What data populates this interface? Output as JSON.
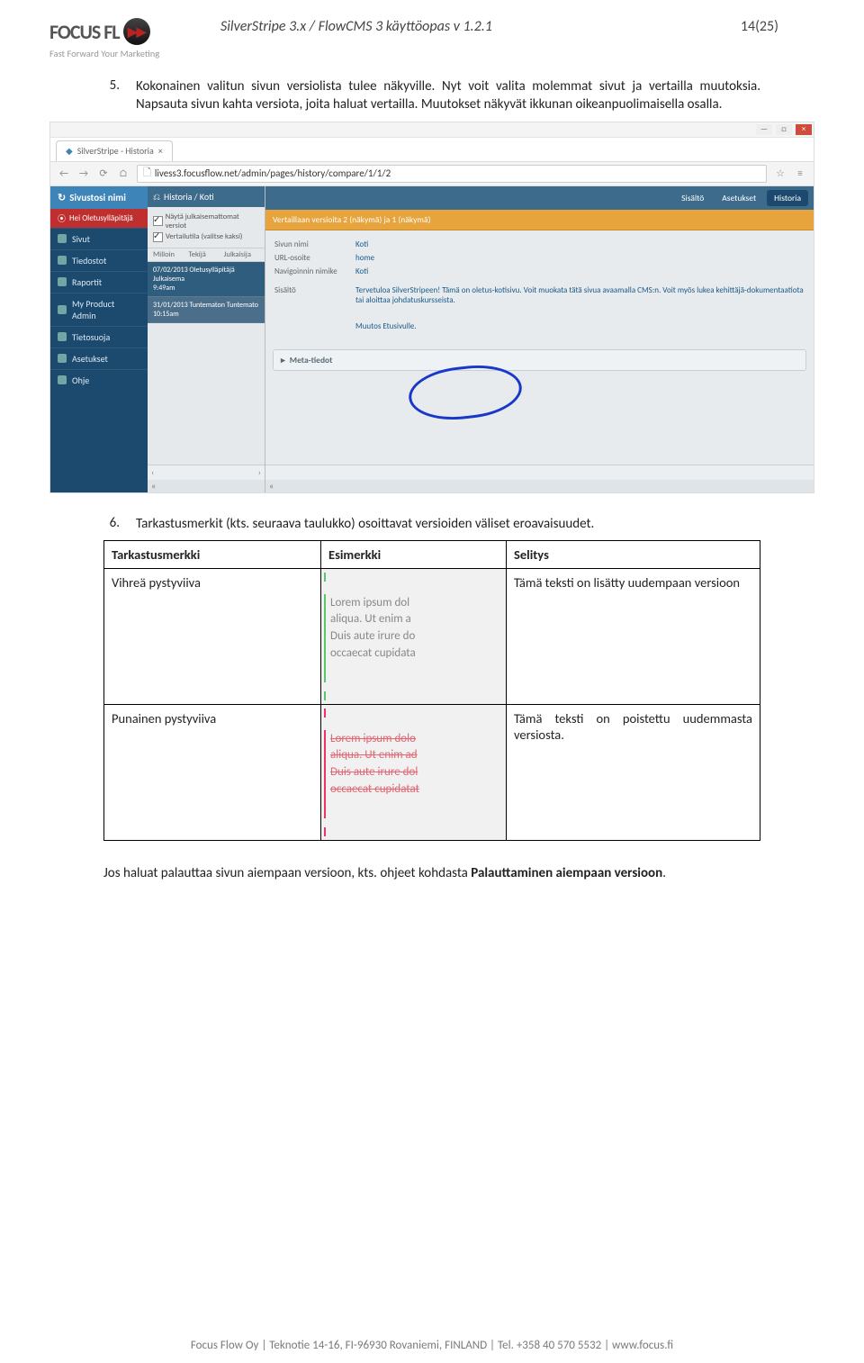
{
  "header": {
    "logo_text": "FOCUS FL",
    "logo_icon": "▶▶",
    "tagline": "Fast Forward Your Marketing",
    "doc_title": "SilverStripe 3.x / FlowCMS 3 käyttöopas v 1.2.1",
    "page_counter": "14(25)"
  },
  "steps": {
    "s5_num": "5.",
    "s5_text": "Kokonainen valitun sivun versiolista tulee näkyville. Nyt voit valita molemmat sivut ja vertailla muutoksia. Napsauta sivun kahta versiota, joita haluat vertailla. Muutokset näkyvät ikkunan oikeanpuolimaisella osalla.",
    "s6_num": "6.",
    "s6_text": "Tarkastusmerkit (kts. seuraava taulukko) osoittavat versioiden väliset eroavaisuudet."
  },
  "screenshot": {
    "window_min": "—",
    "window_max": "□",
    "window_close": "×",
    "tab_title": "SilverStripe - Historia",
    "tab_close": "×",
    "nav_back": "←",
    "nav_fwd": "→",
    "nav_reload": "⟳",
    "nav_home": "⌂",
    "url": "livess3.focusflow.net/admin/pages/history/compare/1/1/2",
    "star": "☆",
    "menu": "≡",
    "site_name": "Sivustosi nimi",
    "hello": "Hei Oletusylläpitäjä",
    "nav": [
      "Sivut",
      "Tiedostot",
      "Raportit",
      "My Product Admin",
      "Tietosuoja",
      "Asetukset",
      "Ohje"
    ],
    "mid_breadcrumb": "Historia / Koti",
    "chk1": "Näytä julkaisemattomat versiot",
    "chk2": "Vertailutila (valitse kaksi)",
    "th_when": "Milloin",
    "th_who": "Tekijä",
    "th_pub": "Julkaisija",
    "row1": "07/02/2013  Oletusylläpitäjä  Julkaisema",
    "row1_time": "9:49am",
    "row2": "31/01/2013  Tuntematon  Tuntemato",
    "row2_time": "10:15am",
    "tabs": {
      "content": "Sisältö",
      "settings": "Asetukset",
      "history": "Historia"
    },
    "banner": "Vertaillaan versioita 2 (näkymä) ja 1 (näkymä)",
    "fields": {
      "name_lbl": "Sivun nimi",
      "name_val": "Koti",
      "url_lbl": "URL-osoite",
      "url_val": "home",
      "nav_lbl": "Navigoinnin nimike",
      "nav_val": "Koti",
      "content_lbl": "Sisältö",
      "content_val": "Tervetuloa SilverStripeen! Tämä on oletus-kotisivu. Voit muokata tätä sivua avaamalla CMS:n. Voit myös lukea kehittäjä-dokumentaatiota tai aloittaa johdatuskursseista.",
      "content_change": "Muutos Etusivulle."
    },
    "accordion": "Meta-tiedot",
    "acc_arrow": "▸",
    "scroll_l": "‹",
    "scroll_r": "›",
    "scroll_ll": "«",
    "scroll_rr": "«"
  },
  "table": {
    "h1": "Tarkastusmerkki",
    "h2": "Esimerkki",
    "h3": "Selitys",
    "r1_label": "Vihreä pystyviiva",
    "r1_desc": "Tämä teksti on lisätty uudempaan versioon",
    "r1_ex_l1": "Lorem ipsum dol",
    "r1_ex_l2": "aliqua. Ut enim a",
    "r1_ex_l3": "Duis aute irure do",
    "r1_ex_l4": "occaecat cupidata",
    "r2_label": "Punainen pystyviiva",
    "r2_desc": "Tämä teksti on poistettu uudemmasta versiosta.",
    "r2_ex_l1": "Lorem ipsum dolo",
    "r2_ex_l2": "aliqua. Ut enim ad",
    "r2_ex_l3": "Duis aute irure dol",
    "r2_ex_l4": "occaecat cupidatat"
  },
  "final": {
    "text_a": "Jos haluat palauttaa sivun aiempaan versioon, kts. ohjeet kohdasta ",
    "text_b": "Palauttaminen aiempaan versioon",
    "text_c": "."
  },
  "footer": "Focus Flow Oy  |  Teknotie 14-16, FI-96930 Rovaniemi, FINLAND  |  Tel. +358 40 570 5532  |  www.focus.fi"
}
